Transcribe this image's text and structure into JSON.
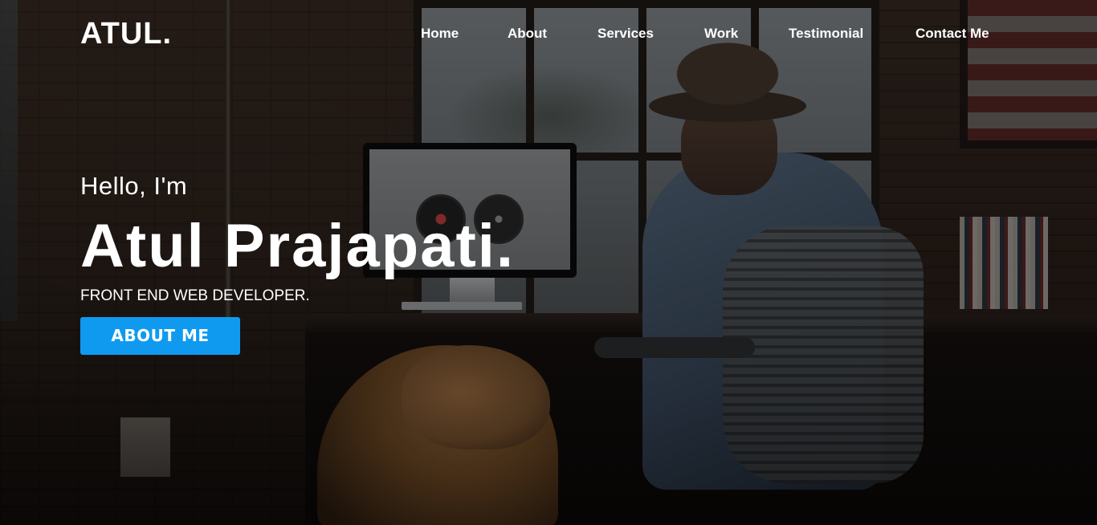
{
  "nav": {
    "logo": "ATUL.",
    "links": [
      {
        "label": "Home"
      },
      {
        "label": "About"
      },
      {
        "label": "Services"
      },
      {
        "label": "Work"
      },
      {
        "label": "Testimonial"
      },
      {
        "label": "Contact Me"
      }
    ]
  },
  "hero": {
    "greeting": "Hello, I'm",
    "name": "Atul Prajapati.",
    "role": "FRONT END WEB DEVELOPER.",
    "button_label": "ABOUT ME"
  },
  "colors": {
    "accent": "#0f9af0",
    "text": "#ffffff"
  }
}
